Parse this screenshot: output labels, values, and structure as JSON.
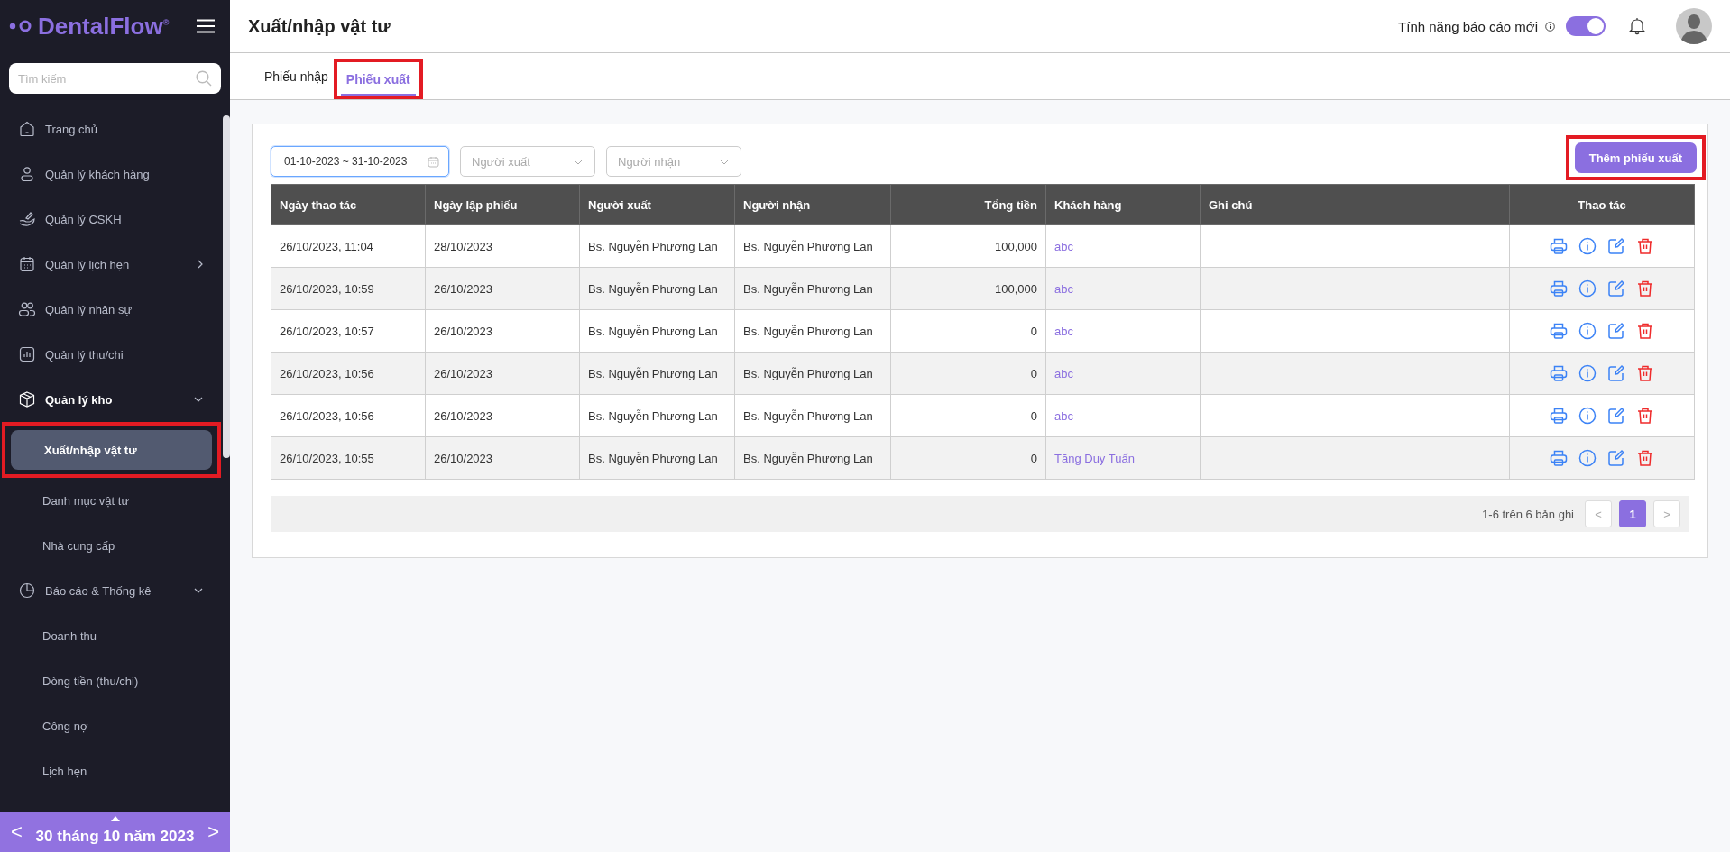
{
  "sidebar": {
    "logo": "DentalFlow$^{®}$",
    "search": {
      "placeholder": "Tìm kiếm"
    },
    "items": [
      {
        "label": "Trang chủ"
      },
      {
        "label": "Quản lý khách hàng"
      },
      {
        "label": "Quản lý CSKH"
      },
      {
        "label": "Quản lý lịch hẹn",
        "expanded": false
      },
      {
        "label": "Quản lý nhân sự"
      },
      {
        "label": "Quản lý thu/chi"
      },
      {
        "label": "Quản lý kho",
        "expanded": true,
        "children": [
          {
            "label": "Xuất/nhập vật tư",
            "selected": true,
            "highlighted": true
          },
          {
            "label": "Danh mục vật tư",
            "selected": false,
            "highlighted": false
          },
          {
            "label": "Nhà cung cấp",
            "selected": false,
            "highlighted": false
          }
        ]
      },
      {
        "label": "Báo cáo & Thống kê",
        "expanded": true,
        "children": [
          {
            "label": "Doanh thu",
            "selected": false,
            "highlighted": false
          },
          {
            "label": "Dòng tiền (thu/chi)",
            "selected": false,
            "highlighted": false
          },
          {
            "label": "Công nợ",
            "selected": false,
            "highlighted": false
          },
          {
            "label": "Lịch hẹn",
            "selected": false,
            "highlighted": false
          }
        ]
      }
    ],
    "date_bar": {
      "prev": "<",
      "date": "30 tháng 10 năm 2023",
      "next": ">"
    }
  },
  "header": {
    "title": "Xuất/nhập vật tư",
    "feature_label": "Tính năng báo cáo mới",
    "feature_toggle": {
      "on": true
    }
  },
  "tabs": [
    {
      "label": "Phiếu nhập",
      "selected": false,
      "highlighted": false
    },
    {
      "label": "Phiếu xuất",
      "selected": true,
      "highlighted": true
    }
  ],
  "filters": {
    "date_range": "01-10-2023 ~ 31-10-2023",
    "issuer": {
      "placeholder": "Người xuất"
    },
    "receiver": {
      "placeholder": "Người nhận"
    }
  },
  "add_button": {
    "label": "Thêm phiếu xuất",
    "highlighted": true
  },
  "table": {
    "columns": [
      {
        "label": "Ngày thao tác",
        "kind": "text"
      },
      {
        "label": "Ngày lập phiếu",
        "kind": "text"
      },
      {
        "label": "Người xuất",
        "kind": "text"
      },
      {
        "label": "Người nhận",
        "kind": "text"
      },
      {
        "label": "Tổng tiền",
        "kind": "money"
      },
      {
        "label": "Khách hàng",
        "kind": "link"
      },
      {
        "label": "Ghi chú",
        "kind": "note"
      },
      {
        "label": "Thao tác",
        "kind": "actions"
      }
    ],
    "rows": [
      {
        "cells": [
          "26/10/2023, 11:04",
          "28/10/2023",
          "Bs. Nguyễn Phương Lan",
          "Bs. Nguyễn Phương Lan",
          "100,000",
          "abc"
        ]
      },
      {
        "cells": [
          "26/10/2023, 10:59",
          "26/10/2023",
          "Bs. Nguyễn Phương Lan",
          "Bs. Nguyễn Phương Lan",
          "100,000",
          "abc"
        ]
      },
      {
        "cells": [
          "26/10/2023, 10:57",
          "26/10/2023",
          "Bs. Nguyễn Phương Lan",
          "Bs. Nguyễn Phương Lan",
          "0",
          "abc"
        ]
      },
      {
        "cells": [
          "26/10/2023, 10:56",
          "26/10/2023",
          "Bs. Nguyễn Phương Lan",
          "Bs. Nguyễn Phương Lan",
          "0",
          "abc"
        ]
      },
      {
        "cells": [
          "26/10/2023, 10:56",
          "26/10/2023",
          "Bs. Nguyễn Phương Lan",
          "Bs. Nguyễn Phương Lan",
          "0",
          "abc"
        ]
      },
      {
        "cells": [
          "26/10/2023, 10:55",
          "26/10/2023",
          "Bs. Nguyễn Phương Lan",
          "Bs. Nguyễn Phương Lan",
          "0",
          "Tăng Duy Tuấn"
        ]
      }
    ]
  },
  "pagination": {
    "summary": "1-6 trên 6 bản ghi",
    "prev": "<",
    "pages": [
      {
        "label": "1",
        "selected": true
      }
    ],
    "next": ">"
  }
}
